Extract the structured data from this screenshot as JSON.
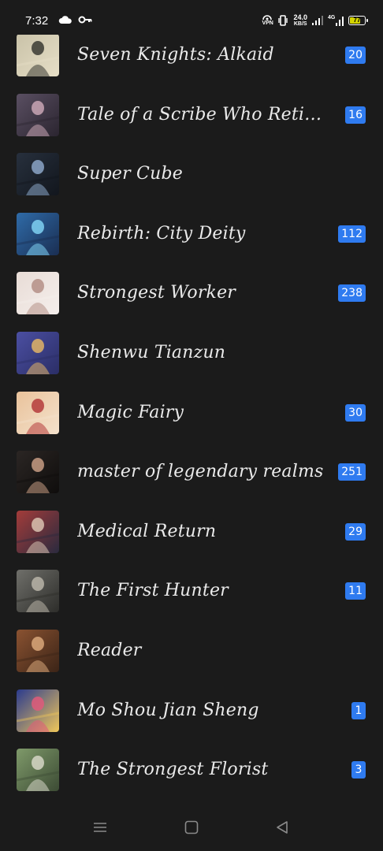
{
  "status_bar": {
    "time": "7:32",
    "vpn": "VPN",
    "speed_value": "24.0",
    "speed_unit": "KB/S",
    "network": "4G",
    "battery": "77",
    "battery_level": 0.77,
    "icons": [
      "cloud-icon",
      "key-icon",
      "vpn-icon",
      "vibrate-icon",
      "signal-icon",
      "signal-4g-icon",
      "battery-icon"
    ]
  },
  "items": [
    {
      "title": "Seven Knights: Alkaid",
      "badge": "20",
      "cover_colors": [
        "#c9c2a8",
        "#3a3a33",
        "#e7dfc7"
      ]
    },
    {
      "title": "Tale of a Scribe Who Retire...",
      "badge": "16",
      "cover_colors": [
        "#5a4f62",
        "#c9a6b5",
        "#2b2530"
      ]
    },
    {
      "title": "Super Cube",
      "badge": "",
      "cover_colors": [
        "#27303d",
        "#8ba5c7",
        "#12161d"
      ]
    },
    {
      "title": "Rebirth: City Deity",
      "badge": "112",
      "cover_colors": [
        "#2f6ba8",
        "#7fd1f2",
        "#1a2e52"
      ]
    },
    {
      "title": "Strongest Worker",
      "badge": "238",
      "cover_colors": [
        "#e8dcd6",
        "#b48f86",
        "#f5efec"
      ]
    },
    {
      "title": "Shenwu Tianzun",
      "badge": "",
      "cover_colors": [
        "#4b4fa2",
        "#e2b466",
        "#2b2e66"
      ]
    },
    {
      "title": "Magic Fairy",
      "badge": "30",
      "cover_colors": [
        "#e9c29b",
        "#b43b3b",
        "#f4e2cc"
      ]
    },
    {
      "title": "master of legendary realms",
      "badge": "251",
      "cover_colors": [
        "#2b2624",
        "#c79c84",
        "#0f0d0c"
      ]
    },
    {
      "title": "Medical Return",
      "badge": "29",
      "cover_colors": [
        "#a33c3a",
        "#d9c2b0",
        "#2a2a3e"
      ]
    },
    {
      "title": "The First Hunter",
      "badge": "11",
      "cover_colors": [
        "#6f6f6a",
        "#b9b4a8",
        "#2d2d2a"
      ]
    },
    {
      "title": "Reader",
      "badge": "",
      "cover_colors": [
        "#8a5231",
        "#d9a77a",
        "#3b2417"
      ]
    },
    {
      "title": "Mo Shou Jian Sheng",
      "badge": "1",
      "cover_colors": [
        "#2b3b8e",
        "#e05a7a",
        "#f0c75a"
      ]
    },
    {
      "title": "The Strongest Florist",
      "badge": "3",
      "cover_colors": [
        "#7f9a6a",
        "#d6d6c6",
        "#3c4b34"
      ]
    }
  ],
  "nav_bar": {
    "icons": [
      "menu-icon",
      "home-icon",
      "back-icon"
    ]
  },
  "colors": {
    "background": "#1b1b1b",
    "badge": "#2f7bf0",
    "text": "#eaeaea"
  }
}
